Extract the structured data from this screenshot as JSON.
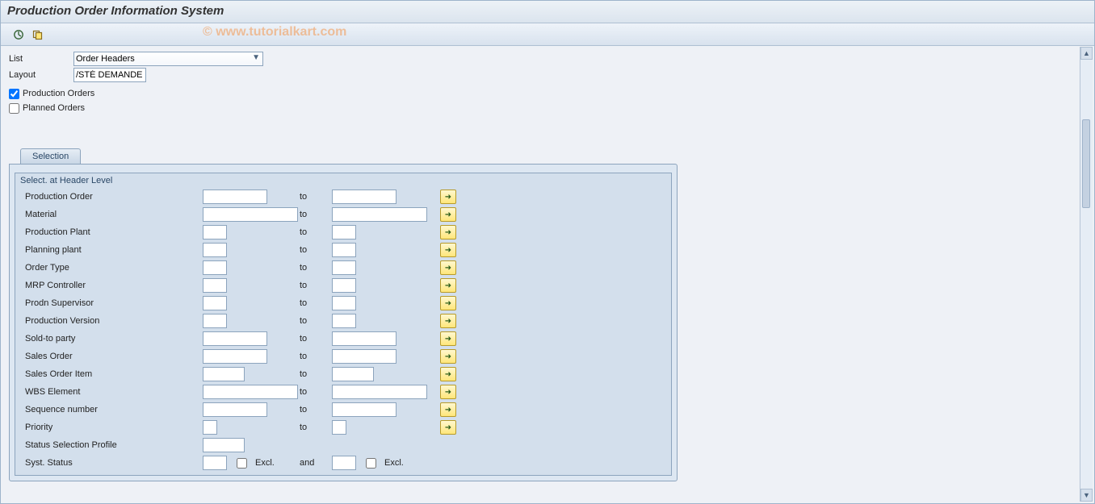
{
  "title": "Production Order Information System",
  "watermark": "© www.tutorialkart.com",
  "list_label": "List",
  "list_value": "Order Headers",
  "layout_label": "Layout",
  "layout_value": "/STÉ DEMANDE",
  "cb_prod": "Production Orders",
  "cb_plan": "Planned Orders",
  "tab_label": "Selection",
  "group_title": "Select. at Header Level",
  "to_label": "to",
  "and_label": "and",
  "excl_label": "Excl.",
  "rows": {
    "prod_order": "Production Order",
    "material": "Material",
    "prod_plant": "Production Plant",
    "plan_plant": "Planning plant",
    "order_type": "Order Type",
    "mrp_ctrl": "MRP Controller",
    "prodn_sup": "Prodn Supervisor",
    "prod_ver": "Production Version",
    "sold_to": "Sold-to party",
    "sales_ord": "Sales Order",
    "sales_item": "Sales Order Item",
    "wbs": "WBS Element",
    "seq_no": "Sequence number",
    "priority": "Priority",
    "status_prof": "Status Selection Profile",
    "syst_stat": "Syst. Status"
  }
}
